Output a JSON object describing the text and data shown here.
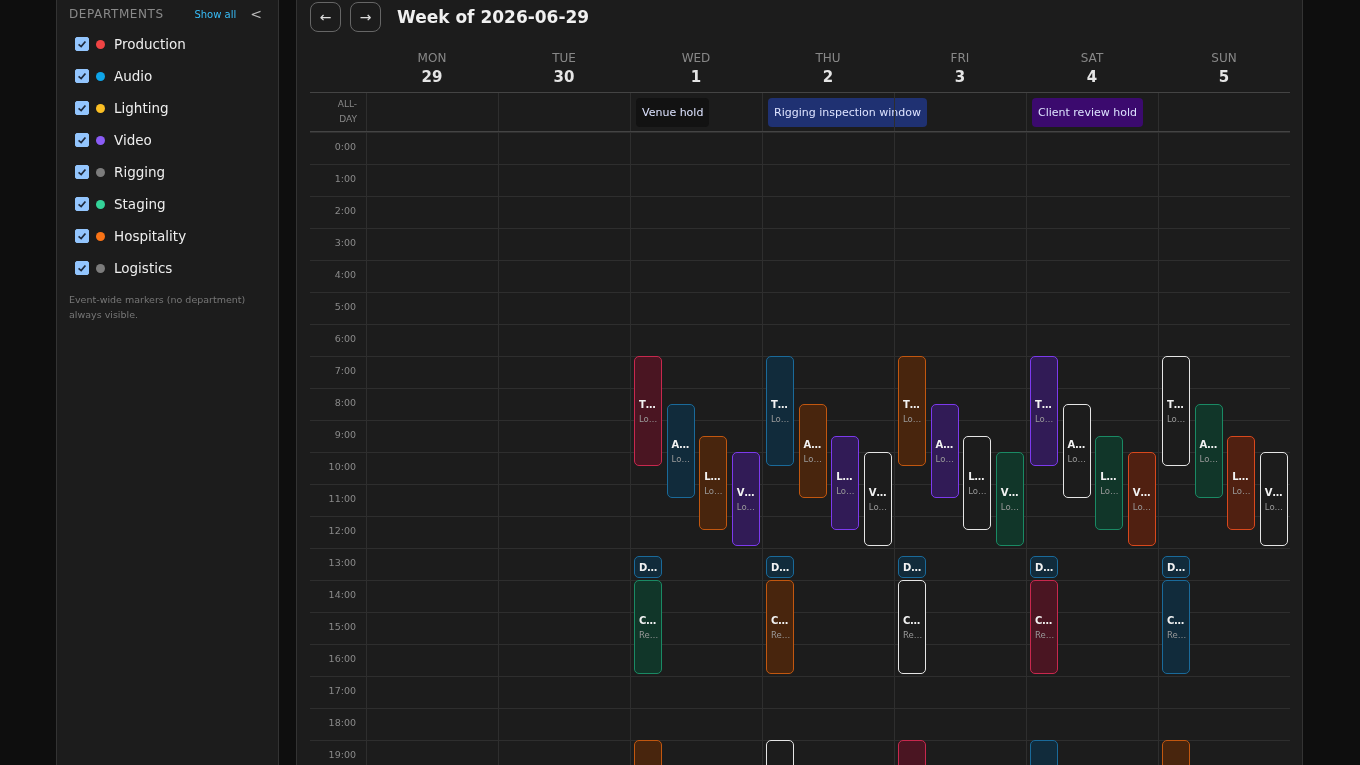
{
  "sidebar": {
    "heading": "DEPARTMENTS",
    "show_all": "Show all",
    "collapse": "<",
    "departments": [
      {
        "name": "Production",
        "checked": true,
        "color": "#ef4444"
      },
      {
        "name": "Audio",
        "checked": true,
        "color": "#0ea5e9"
      },
      {
        "name": "Lighting",
        "checked": true,
        "color": "#fbbf24"
      },
      {
        "name": "Video",
        "checked": true,
        "color": "#8b5cf6"
      },
      {
        "name": "Rigging",
        "checked": true,
        "color": "#7c7c7c"
      },
      {
        "name": "Staging",
        "checked": true,
        "color": "#34d399"
      },
      {
        "name": "Hospitality",
        "checked": true,
        "color": "#f97316"
      },
      {
        "name": "Logistics",
        "checked": true,
        "color": "#7c7c7c"
      }
    ],
    "note": "Event-wide markers (no department) always visible."
  },
  "calendar": {
    "prev": "←",
    "next": "→",
    "title": "Week of 2026-06-29",
    "all_day_label": "ALL-DAY",
    "hours": [
      "0:00",
      "1:00",
      "2:00",
      "3:00",
      "4:00",
      "5:00",
      "6:00",
      "7:00",
      "8:00",
      "9:00",
      "10:00",
      "11:00",
      "12:00",
      "13:00",
      "14:00",
      "15:00",
      "16:00",
      "17:00",
      "18:00",
      "19:00"
    ],
    "days": [
      {
        "weekday": "MON",
        "date": "29"
      },
      {
        "weekday": "TUE",
        "date": "30"
      },
      {
        "weekday": "WED",
        "date": "1",
        "all_day": [
          {
            "title": "Venue hold",
            "color": "#121212"
          }
        ],
        "events": [
          {
            "title": "T…",
            "subtitle": "Lo…",
            "color": "#c8284e"
          },
          {
            "title": "A…",
            "subtitle": "Lo…",
            "color": "#1a6a9a"
          },
          {
            "title": "L…",
            "subtitle": "Lo…",
            "color": "#c2570f"
          },
          {
            "title": "V…",
            "subtitle": "Lo…",
            "color": "#7c3aed"
          },
          {
            "title": "D…",
            "color": "#1a6a9a"
          },
          {
            "title": "C…",
            "subtitle": "Re…",
            "color": "#1a8a64"
          },
          {
            "color": "#c2570f"
          }
        ]
      },
      {
        "weekday": "THU",
        "date": "2",
        "all_day": [
          {
            "title": "Rigging inspection window",
            "color": "#1f3172"
          }
        ],
        "events": [
          {
            "title": "T…",
            "subtitle": "Lo…",
            "color": "#1a6a9a"
          },
          {
            "title": "A…",
            "subtitle": "Lo…",
            "color": "#c2570f"
          },
          {
            "title": "L…",
            "subtitle": "Lo…",
            "color": "#7c3aed"
          },
          {
            "title": "V…",
            "subtitle": "Lo…",
            "color": "#e5e5e5"
          },
          {
            "title": "D…",
            "color": "#1a6a9a"
          },
          {
            "title": "C…",
            "subtitle": "Re…",
            "color": "#c2570f"
          },
          {
            "color": "#e5e5e5"
          }
        ]
      },
      {
        "weekday": "FRI",
        "date": "3",
        "events": [
          {
            "title": "T…",
            "subtitle": "Lo…",
            "color": "#c2570f"
          },
          {
            "title": "A…",
            "subtitle": "Lo…",
            "color": "#7c3aed"
          },
          {
            "title": "L…",
            "subtitle": "Lo…",
            "color": "#e5e5e5"
          },
          {
            "title": "V…",
            "subtitle": "Lo…",
            "color": "#1a8a64"
          },
          {
            "title": "D…",
            "color": "#1a6a9a"
          },
          {
            "title": "C…",
            "subtitle": "Re…",
            "color": "#e5e5e5"
          },
          {
            "color": "#c8284e"
          }
        ]
      },
      {
        "weekday": "SAT",
        "date": "4",
        "all_day": [
          {
            "title": "Client review hold",
            "color": "#3b0a6e"
          }
        ],
        "events": [
          {
            "title": "T…",
            "subtitle": "Lo…",
            "color": "#7c3aed"
          },
          {
            "title": "A…",
            "subtitle": "Lo…",
            "color": "#e5e5e5"
          },
          {
            "title": "L…",
            "subtitle": "Lo…",
            "color": "#1a8a64"
          },
          {
            "title": "V…",
            "subtitle": "Lo…",
            "color": "#d9481c"
          },
          {
            "title": "D…",
            "color": "#1a6a9a"
          },
          {
            "title": "C…",
            "subtitle": "Re…",
            "color": "#c8284e"
          },
          {
            "color": "#1a6a9a"
          }
        ]
      },
      {
        "weekday": "SUN",
        "date": "5",
        "events": [
          {
            "title": "T…",
            "subtitle": "Lo…",
            "color": "#e5e5e5"
          },
          {
            "title": "A…",
            "subtitle": "Lo…",
            "color": "#1a8a64"
          },
          {
            "title": "L…",
            "subtitle": "Lo…",
            "color": "#d9481c"
          },
          {
            "title": "V…",
            "subtitle": "Lo…",
            "color": "#e5e5e5"
          },
          {
            "title": "D…",
            "color": "#1a6a9a"
          },
          {
            "title": "C…",
            "subtitle": "Re…",
            "color": "#1a6a9a"
          },
          {
            "color": "#c2570f"
          }
        ]
      }
    ]
  }
}
